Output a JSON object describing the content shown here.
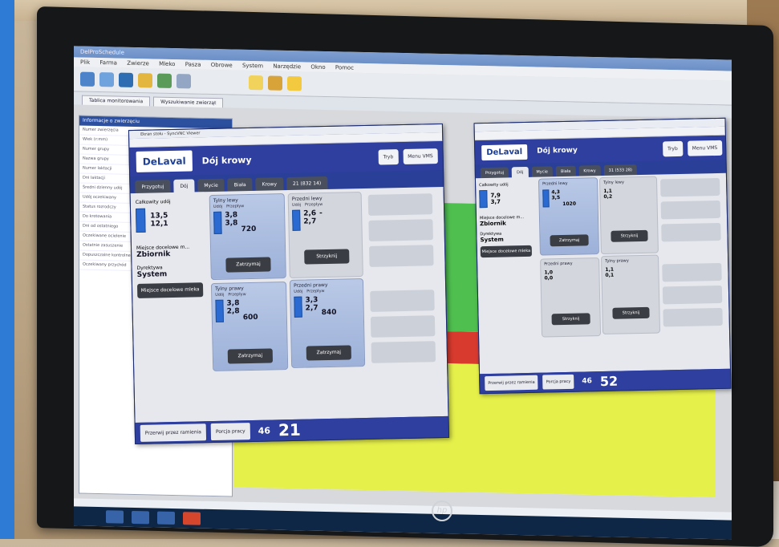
{
  "app": {
    "title": "DelProSchedule"
  },
  "menu": [
    "Plik",
    "Farma",
    "Zwierze",
    "Mleko",
    "Pasza",
    "Obrowe",
    "System",
    "Narzędzie",
    "Okno",
    "Pomoc"
  ],
  "tabs": [
    "Tablica monitorowania",
    "Wyszukiwanie zwierząt"
  ],
  "sidebar": {
    "heading": "Informacje o zwierzęciu",
    "rows": [
      "Numer zwierzęcia",
      "Wiek (r:mm)",
      "Numer grupy",
      "Nazwa grupy",
      "Numer laktacji",
      "Dni laktacji",
      "Średni dzienny udój",
      "Udój oczekiwany",
      "Status rozrodczy",
      "Do krotowania",
      "Dni od ostatniego",
      "Oczekiwane ocielenie",
      "Ostatnie zasuszenie",
      "Dopuszczalne kontrolne",
      "Oczekiwany przychód"
    ]
  },
  "windows": {
    "left": {
      "title": "Ekran stołu - SyncVNC Viewer",
      "logo": "DeLaval",
      "heading": "Dój krowy",
      "btn_tryb": "Tryb",
      "btn_menu": "Menu VMS",
      "tabs": [
        "Przygotuj",
        "Dój",
        "Mycie",
        "Biała",
        "Krowy",
        "21 (832 14)"
      ],
      "total_label": "Całkowity udój",
      "total_1": "13,5",
      "total_2": "12,1",
      "dest_label": "Miejsce docelowe m...",
      "dest_value": "Zbiornik",
      "dir_label": "Dyrektywa",
      "dir_value": "System",
      "dest_btn": "Miejsce docelowe mleka",
      "p_tl": {
        "title": "Tylny lewy",
        "udoj": "Udój",
        "przeplyw": "Przepływ",
        "v1": "3,8",
        "v2": "3,8",
        "flow": "720",
        "btn": "Zatrzymaj"
      },
      "p_tr": {
        "title": "Przedni lewy",
        "udoj": "Udój",
        "przeplyw": "Przepływ",
        "v1": "2,6",
        "v2": "2,7",
        "flow": "-",
        "btn": "Strzyknij"
      },
      "p_bl": {
        "title": "Tylny prawy",
        "udoj": "Udój",
        "przeplyw": "Przepływ",
        "v1": "3,8",
        "v2": "2,8",
        "flow": "600",
        "btn": "Zatrzymaj"
      },
      "p_br": {
        "title": "Przedni prawy",
        "udoj": "Udój",
        "przeplyw": "Przepływ",
        "v1": "3,3",
        "v2": "2,7",
        "flow": "840",
        "btn": "Zatrzymaj"
      },
      "foot_btn1": "Przerwij przez ramienia",
      "foot_btn2": "Porcja pracy",
      "foot_small": "46",
      "foot_big": "21"
    },
    "right": {
      "logo": "DeLaval",
      "heading": "Dój krowy",
      "btn_tryb": "Tryb",
      "btn_menu": "Menu VMS",
      "tabs": [
        "Przygotuj",
        "Dój",
        "Mycie",
        "Biała",
        "Krowy",
        "31 (533 28)"
      ],
      "total_label": "Całkowity udój",
      "total_1": "7,9",
      "total_2": "3,7",
      "dest_label": "Miejsce docelowe m...",
      "dest_value": "Zbiornik",
      "dir_label": "Dyrektywa",
      "dir_value": "System",
      "dest_btn": "Miejsce docelowe mleka",
      "p_tl": {
        "title": "Przedni lewy",
        "v1": "4,3",
        "v2": "3,5",
        "flow": "1020",
        "btn": "Zatrzymaj"
      },
      "p_tr": {
        "title": "Tylny lewy",
        "v1": "1,1",
        "v2": "0,2",
        "btn": "Strzyknij"
      },
      "p_bl": {
        "title": "Przedni prawy",
        "v1": "1,0",
        "v2": "0,0",
        "btn": "Strzyknij"
      },
      "p_br": {
        "title": "Tylny prawy",
        "v1": "1,1",
        "v2": "0,1",
        "btn": "Strzyknij"
      },
      "foot_btn1": "Przerwij przez ramienia",
      "foot_btn2": "Porcja pracy",
      "foot_small": "46",
      "foot_big": "52"
    }
  },
  "brand": "hp"
}
